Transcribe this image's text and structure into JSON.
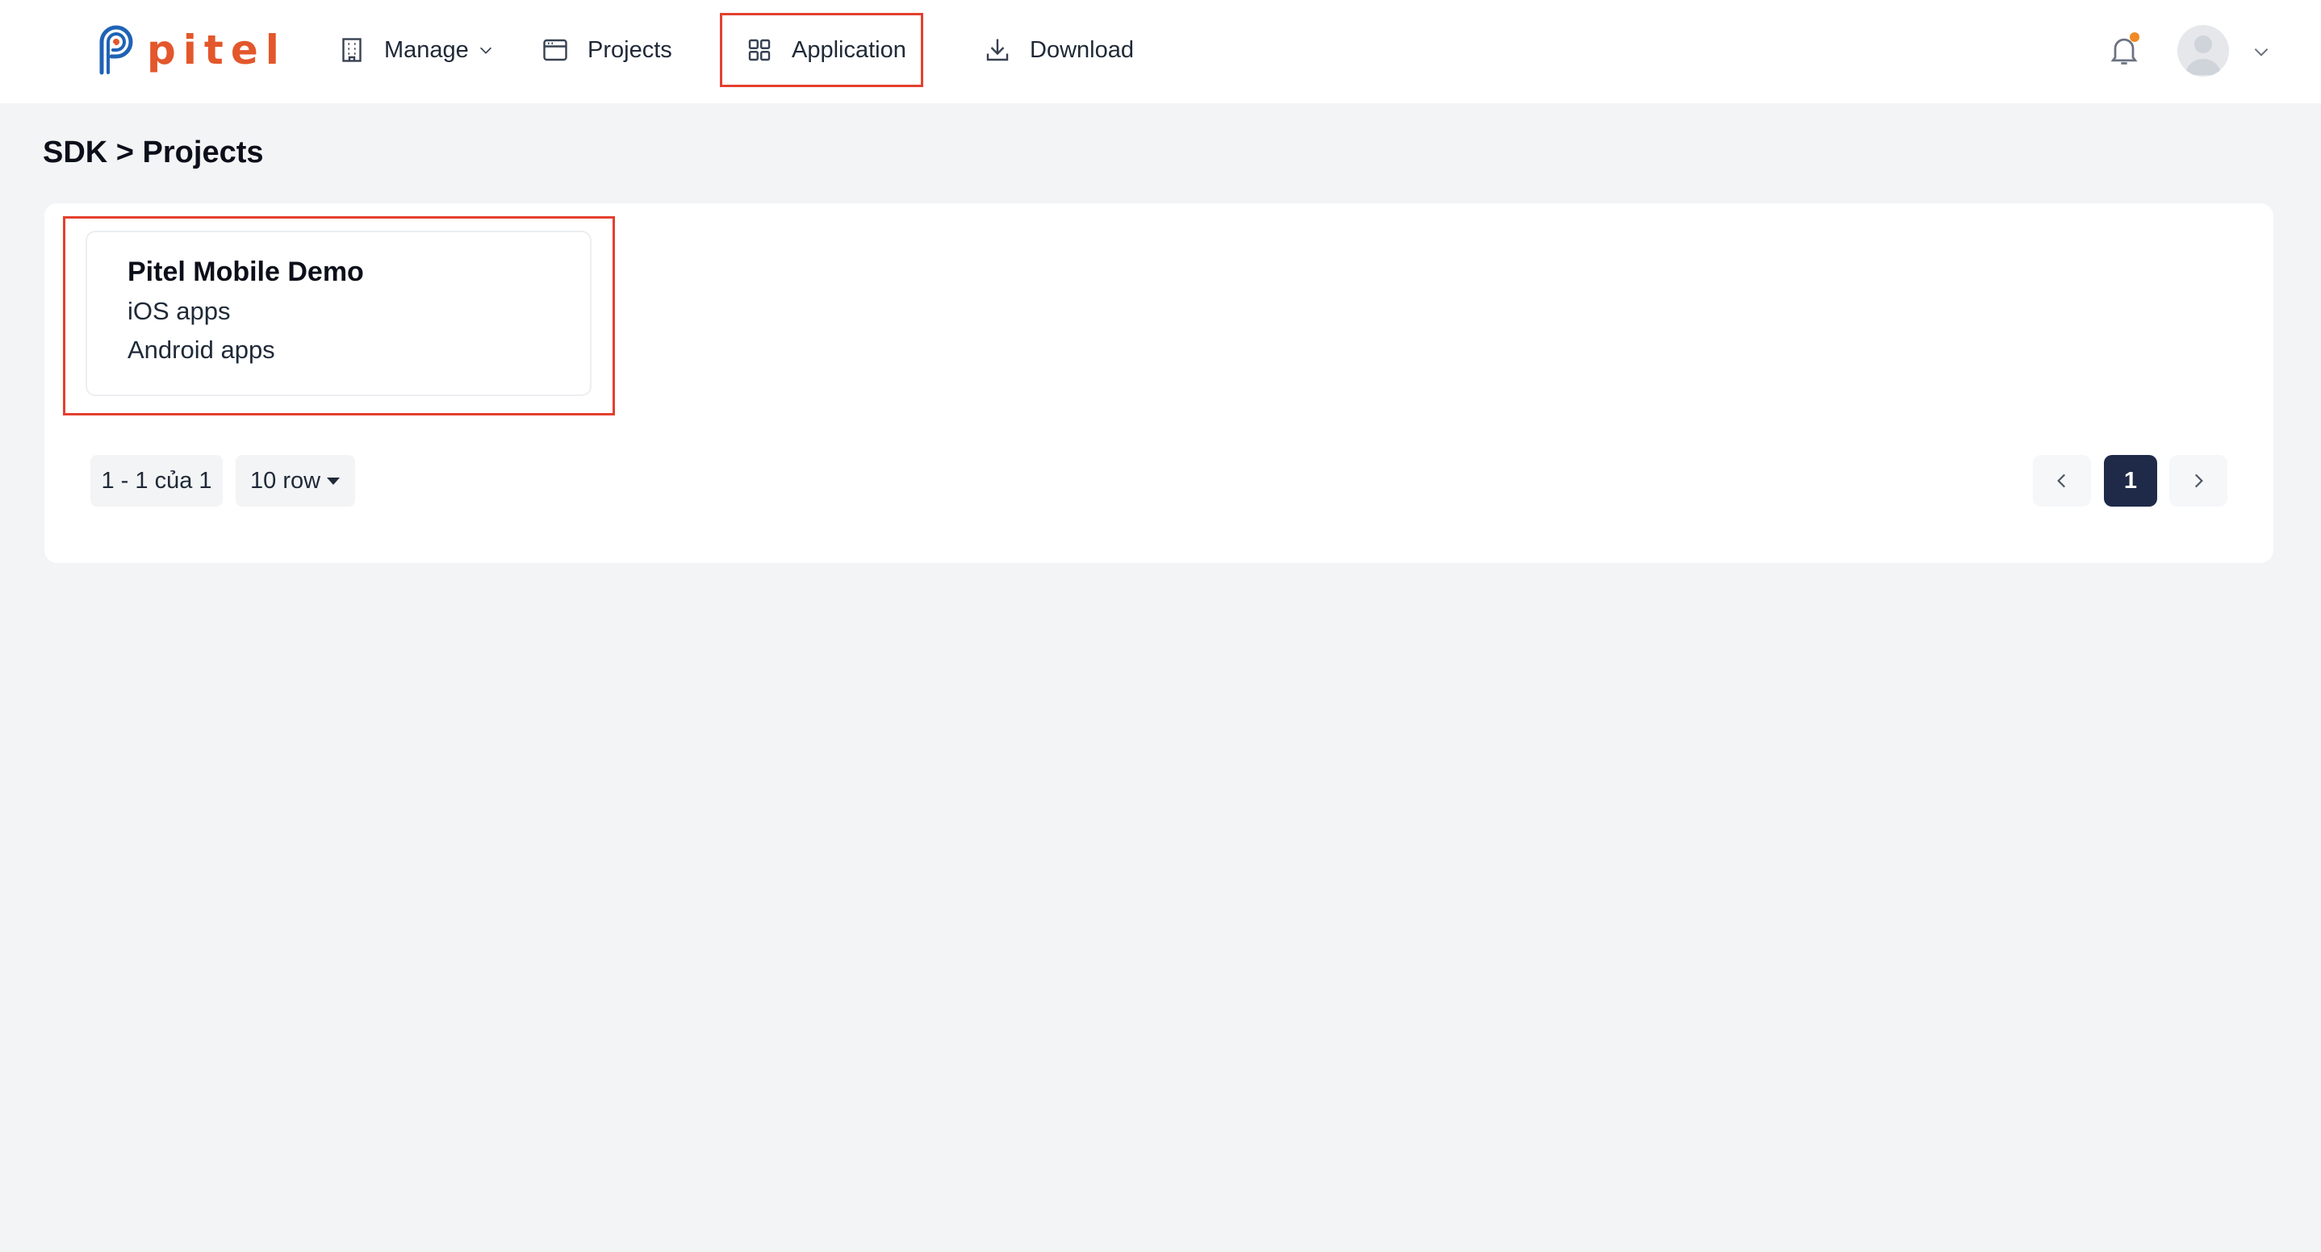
{
  "header": {
    "logo_text": "pitel",
    "nav": {
      "manage": "Manage",
      "projects": "Projects",
      "application": "Application",
      "download": "Download"
    }
  },
  "page": {
    "title": "SDK > Projects"
  },
  "projects": [
    {
      "name": "Pitel Mobile Demo",
      "lines": [
        "iOS apps",
        "Android apps"
      ]
    }
  ],
  "pagination": {
    "range": "1 - 1 của 1",
    "rows_per_page": "10 row",
    "current_page": "1"
  },
  "colors": {
    "brand_orange": "#e3572b",
    "brand_blue": "#1f63b5",
    "highlight_red": "#e3402f",
    "active_page": "#1e2a47",
    "notification_dot": "#f08a24"
  },
  "icons": {
    "manage": "building-icon",
    "projects": "browser-window-icon",
    "application": "grid-icon",
    "download": "download-icon"
  }
}
